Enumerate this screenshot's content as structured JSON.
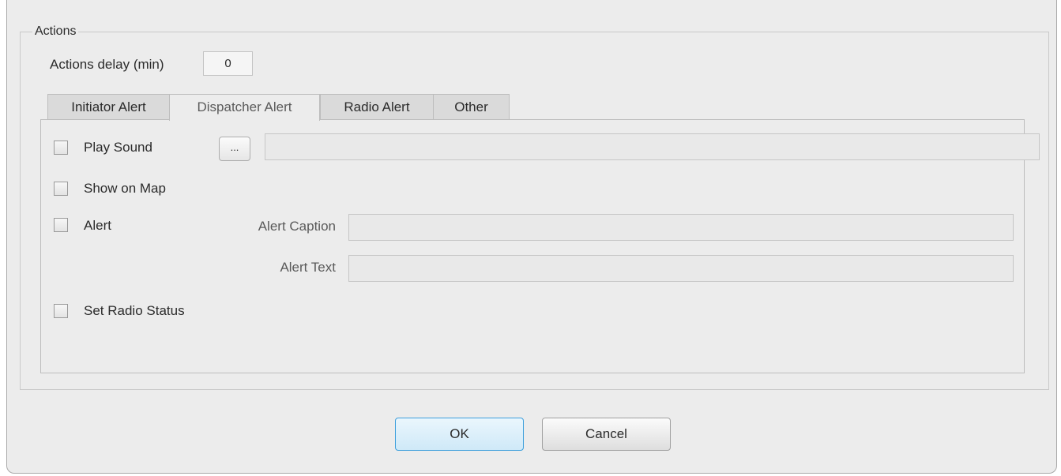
{
  "actions": {
    "group_title": "Actions",
    "delay_label": "Actions delay (min)",
    "delay_value": "0"
  },
  "tabs": [
    {
      "label": "Initiator Alert",
      "active": false
    },
    {
      "label": "Dispatcher Alert",
      "active": true
    },
    {
      "label": "Radio Alert",
      "active": false
    },
    {
      "label": "Other",
      "active": false
    }
  ],
  "panel": {
    "play_sound": {
      "label": "Play Sound",
      "checked": false,
      "browse_label": "...",
      "path_value": ""
    },
    "show_on_map": {
      "label": "Show on Map",
      "checked": false
    },
    "alert": {
      "label": "Alert",
      "checked": false,
      "caption_label": "Alert Caption",
      "caption_value": "",
      "text_label": "Alert Text",
      "text_value": ""
    },
    "set_radio_status": {
      "label": "Set Radio Status",
      "checked": false
    }
  },
  "buttons": {
    "ok": "OK",
    "cancel": "Cancel"
  }
}
